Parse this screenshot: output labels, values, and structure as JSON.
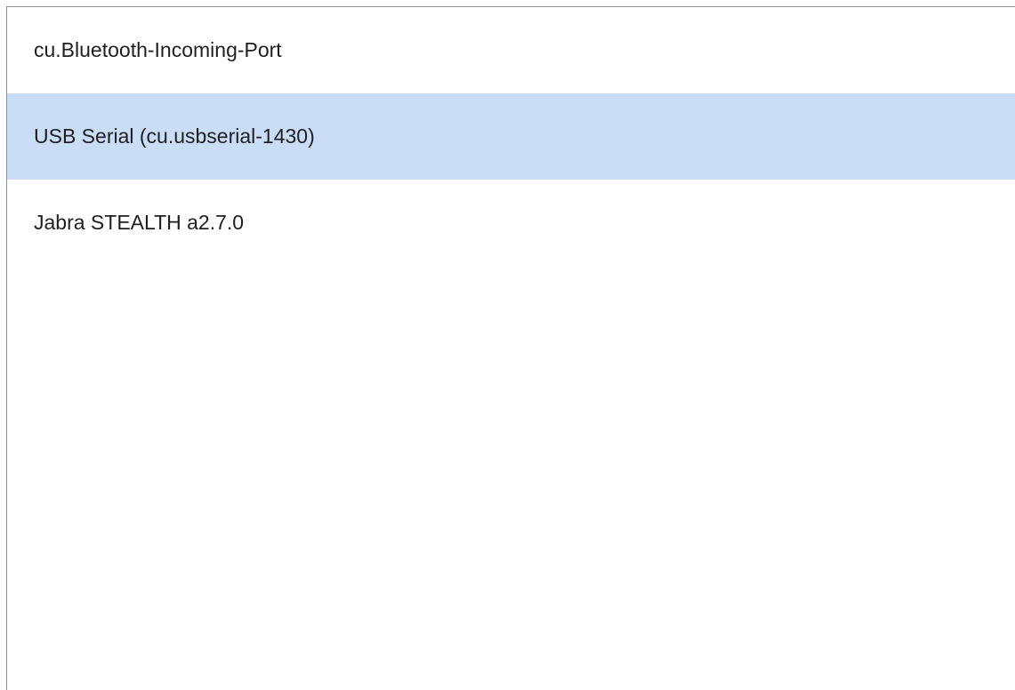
{
  "port_list": {
    "items": [
      {
        "label": "cu.Bluetooth-Incoming-Port",
        "selected": false
      },
      {
        "label": "USB Serial (cu.usbserial-1430)",
        "selected": true
      },
      {
        "label": "Jabra STEALTH a2.7.0",
        "selected": false
      }
    ],
    "selection_color": "#c9ddf7",
    "border_color": "#8e8e8e"
  }
}
